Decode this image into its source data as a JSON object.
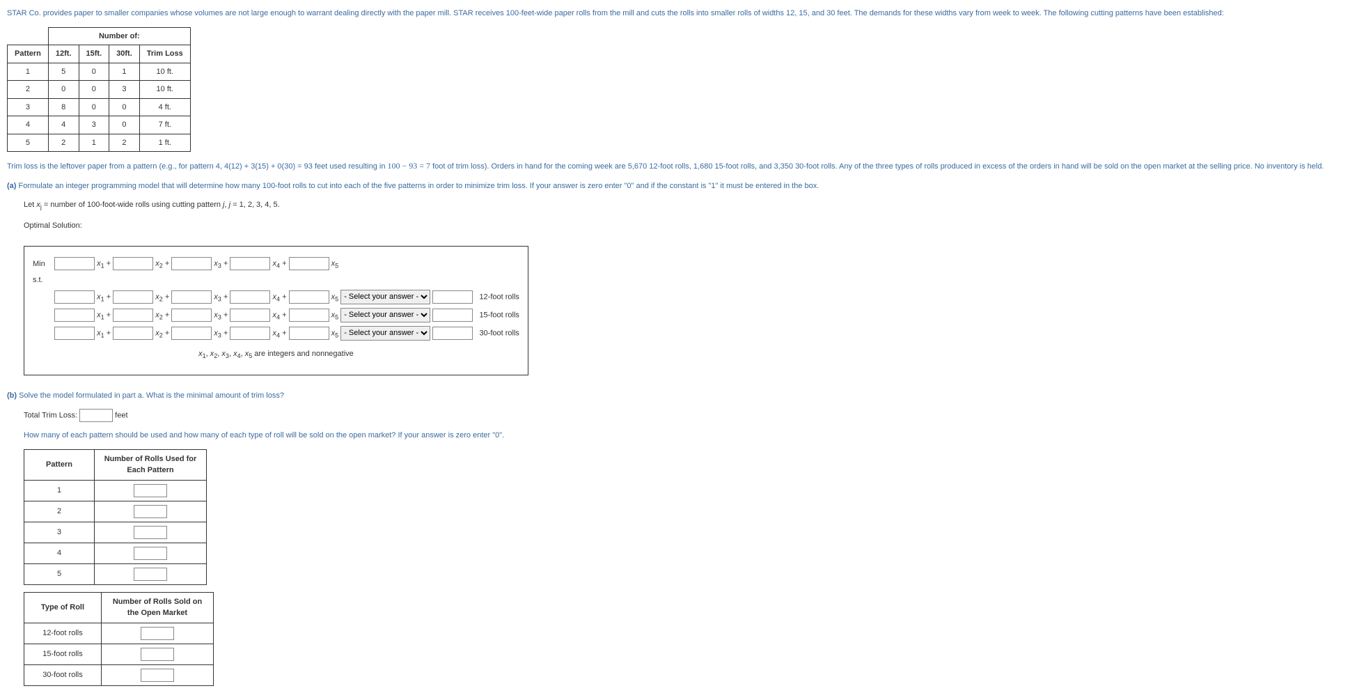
{
  "intro": "STAR Co. provides paper to smaller companies whose volumes are not large enough to warrant dealing directly with the paper mill. STAR receives 100-feet-wide paper rolls from the mill and cuts the rolls into smaller rolls of widths 12, 15, and 30 feet. The demands for these widths vary from week to week. The following cutting patterns have been established:",
  "patternTable": {
    "topHeader": "Number of:",
    "headers": [
      "Pattern",
      "12ft.",
      "15ft.",
      "30ft.",
      "Trim Loss"
    ],
    "rows": [
      [
        "1",
        "5",
        "0",
        "1",
        "10 ft."
      ],
      [
        "2",
        "0",
        "0",
        "3",
        "10 ft."
      ],
      [
        "3",
        "8",
        "0",
        "0",
        "4 ft."
      ],
      [
        "4",
        "4",
        "3",
        "0",
        "7 ft."
      ],
      [
        "5",
        "2",
        "1",
        "2",
        "1 ft."
      ]
    ]
  },
  "trimLossExplain1": "Trim loss is the leftover paper from a pattern (e.g., for pattern 4, 4(12) + 3(15) + 0(30) = 93 feet used resulting in ",
  "trimLossMath": "100 − 93 = 7",
  "trimLossExplain2": " foot of trim loss). Orders in hand for the coming week are 5,670 12-foot rolls, 1,680 15-foot rolls, and 3,350 30-foot rolls. Any of the three types of rolls produced in excess of the orders in hand will be sold on the open market at the selling price. No inventory is held.",
  "partA": {
    "label": "(a)",
    "text": " Formulate an integer programming model that will determine how many 100-foot rolls to cut into each of the five patterns in order to minimize trim loss. If your answer is zero enter \"0\" and if the constant is \"1\" it must be entered in the box.",
    "let1": "Let ",
    "letVar": "x",
    "letSub": "j",
    "let2": " = number of 100-foot-wide rolls using cutting pattern ",
    "letJ": "j",
    "let3": ", ",
    "letJ2": "j",
    "let4": " = 1, 2, 3, 4, 5.",
    "optimal": "Optimal Solution:"
  },
  "form": {
    "min": "Min",
    "st": "s.t.",
    "x1": "x",
    "s1": "1",
    "x2": "x",
    "s2": "2",
    "x3": "x",
    "s3": "3",
    "x4": "x",
    "s4": "4",
    "x5": "x",
    "s5": "5",
    "plus": " + ",
    "selectPlaceholder": "- Select your answer -",
    "c1Label": "12-foot rolls",
    "c2Label": "15-foot rolls",
    "c3Label": "30-foot rolls",
    "intNote1": "x",
    "in1": "1",
    "comma": ", ",
    "intNote": "x 1, x 2, x 3, x 4, x 5 are integers and nonnegative"
  },
  "partB": {
    "label": "(b)",
    "text": " Solve the model formulated in part a. What is the minimal amount of trim loss?",
    "totalTrim": "Total Trim Loss:",
    "feet": "feet",
    "question2": "How many of each pattern should be used and how many of each type of roll will be sold on the open market? If your answer is zero enter \"0\"."
  },
  "usedTable": {
    "h1": "Pattern",
    "h2": "Number of Rolls Used for Each Pattern",
    "rows": [
      "1",
      "2",
      "3",
      "4",
      "5"
    ]
  },
  "soldTable": {
    "h1": "Type of Roll",
    "h2": "Number of Rolls Sold on the Open Market",
    "rows": [
      "12-foot rolls",
      "15-foot rolls",
      "30-foot rolls"
    ]
  }
}
